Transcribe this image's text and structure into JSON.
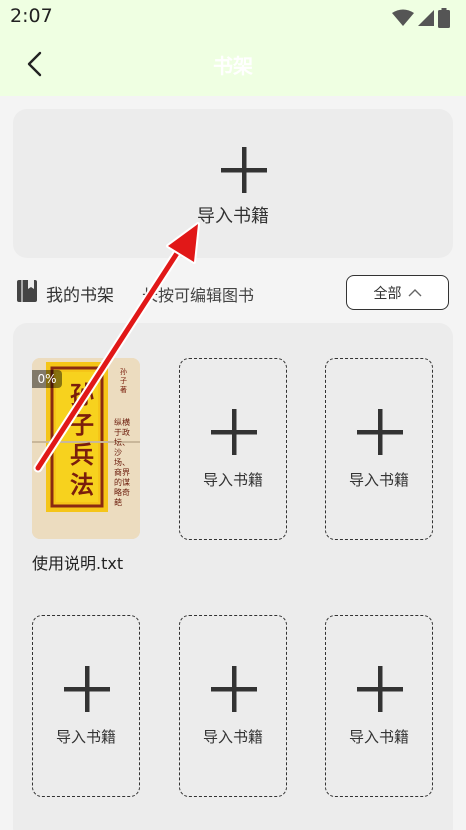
{
  "status_bar": {
    "time": "2:07"
  },
  "app_bar": {
    "title": "书架"
  },
  "import_card": {
    "label": "导入书籍"
  },
  "shelf": {
    "title": "我的书架",
    "hint": "长按可编辑图书",
    "filter_label": "全部"
  },
  "books": [
    {
      "name": "使用说明.txt",
      "progress": "0%",
      "cover_title": "孙子兵法",
      "cover_subtitle": "孙子 著",
      "cover_side_text": "纵横于政坛、沙场、商界的谋略奇葩"
    }
  ],
  "empty_slot_label": "导入书籍",
  "colors": {
    "header_bg": "#efffe2",
    "page_bg": "#f4f4f4",
    "panel_bg": "#ececec",
    "arrow": "#e11818"
  }
}
